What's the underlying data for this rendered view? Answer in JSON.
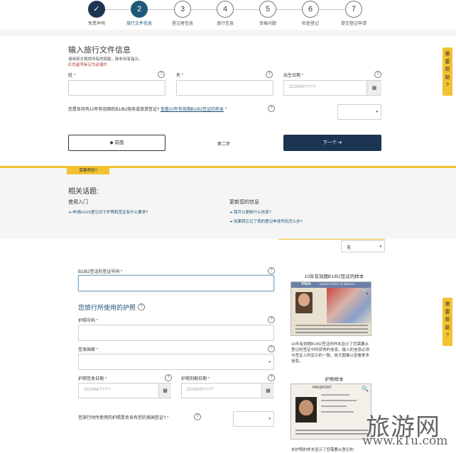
{
  "stepper": {
    "steps": [
      {
        "number": "✓",
        "label": "免责声明",
        "state": "done"
      },
      {
        "number": "2",
        "label": "旅行文件信息",
        "state": "active"
      },
      {
        "number": "3",
        "label": "登记者信息",
        "state": "todo"
      },
      {
        "number": "4",
        "label": "旅行信息",
        "state": "todo"
      },
      {
        "number": "5",
        "label": "资格问题",
        "state": "todo"
      },
      {
        "number": "6",
        "label": "检查登记",
        "state": "todo"
      },
      {
        "number": "7",
        "label": "提交登记申请",
        "state": "todo"
      }
    ]
  },
  "form": {
    "title": "输入旅行文件信息",
    "instruction1": "请用英文规供所有的回复，除非另有指示。",
    "instruction2": "红色星号标记为必填栏",
    "surname_label": "姓",
    "given_name_label": "名",
    "dob_label": "出生日期",
    "dob_placeholder": "DD/MM/YYYY",
    "required_mark": "*",
    "visa_question": "您是否持有10年有效期的B1/B2商务或旅游签证?",
    "visa_sample_link": "查看10年有效期B1/B2签证的样本",
    "prev_label": "◆ 前面",
    "step_indicator": "第二步",
    "next_label": "下一个 ➔"
  },
  "need_help": {
    "label": "需要帮助?",
    "side_tab": "需要帮助?"
  },
  "related": {
    "title": "相关话题:",
    "col1_heading": "使用入门",
    "col1_links": [
      "申请EVUS登记对于护照和签证有什么要求?"
    ],
    "col2_heading": "更新您的信息",
    "col2_links": [
      "我可以更新什么信息?",
      "如果我忘记了我的登记申请号码怎么办?"
    ]
  },
  "visa_form": {
    "top_select_value": "无",
    "visa_number_label": "B1/B2签证的签证号码",
    "passport_section_title": "您旅行所使用的护照",
    "passport_number_label": "护照号码",
    "issuing_country_label": "签发国家",
    "issue_date_label": "护照签发日期",
    "expiry_date_label": "护照到期日期",
    "date_placeholder": "DD/MM/YYYY",
    "us_visa_question": "您旅行时所使用的护照是否含有您的美国签证?",
    "visa_sample_title": "10年有效期B1/B2签证的样本",
    "visa_sample_caption": "10年有效期B1/B2签证的样本显示了您需要从登记的签证中所获得的信息。输入的信息必须与签证上所显示的一致。放大图像以查看更多信息。",
    "visa_image_text": "VISA",
    "visa_image_country": "UNITED STATES OF AMERICA",
    "passport_sample_title": "护照样本",
    "passport_image_text": "PASSPORT",
    "passport_sample_caption": "本护照的样本显示了您需要从登记的"
  },
  "watermark": {
    "cn": "旅游网",
    "en": "www.k1u.com"
  },
  "colors": {
    "navy": "#1c3553",
    "teal": "#1d5a78",
    "help_yellow": "#f2c230",
    "required_red": "#b03030",
    "link_blue": "#1d4f72"
  }
}
